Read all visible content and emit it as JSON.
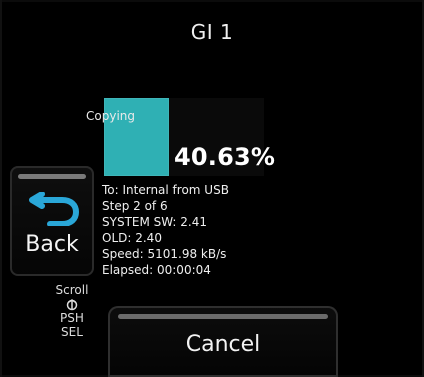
{
  "screen": {
    "title": "GI 1"
  },
  "progress": {
    "label": "Copying",
    "percent_text": "40.63%",
    "value": 0.4063,
    "fill_color": "#2fb0b4"
  },
  "back": {
    "label": "Back",
    "icon": "back-arrow-icon",
    "icon_color": "#2aa7d8"
  },
  "scroll_hint": {
    "line1": "Scroll",
    "line2": "PSH",
    "line3": "SEL",
    "icon": "knob-icon"
  },
  "info": {
    "destination": "To: Internal from USB",
    "step": "Step 2 of 6",
    "system_sw": "SYSTEM SW: 2.41",
    "old": "OLD: 2.40",
    "speed": "Speed: 5101.98 kB/s",
    "elapsed": "Elapsed: 00:00:04"
  },
  "cancel": {
    "label": "Cancel"
  }
}
